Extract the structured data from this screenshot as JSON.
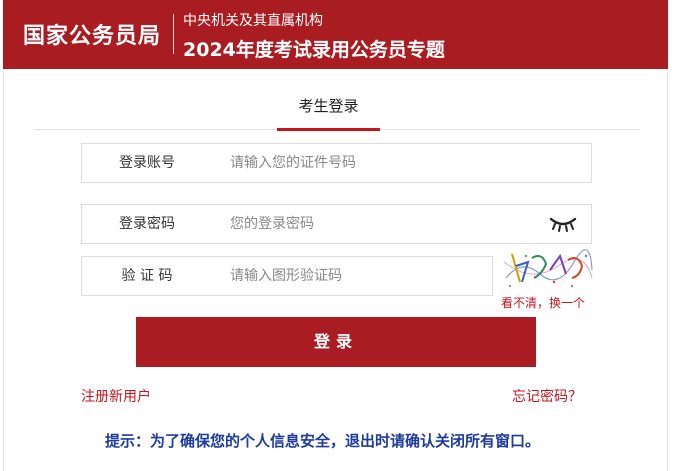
{
  "header": {
    "org": "国家公务员局",
    "subtitle_top": "中央机关及其直属机构",
    "subtitle_main": "2024年度考试录用公务员专题"
  },
  "tab": {
    "label": "考生登录"
  },
  "form": {
    "account": {
      "label": "登录账号",
      "placeholder": "请输入您的证件号码"
    },
    "password": {
      "label": "登录密码",
      "placeholder": "您的登录密码",
      "icon": "eye-closed-icon"
    },
    "captcha": {
      "label": "验 证 码",
      "placeholder": "请输入图形验证码",
      "refresh_label": "看不清，换一个"
    }
  },
  "login_button": {
    "label": "登录"
  },
  "links": {
    "register": "注册新用户",
    "forgot": "忘记密码？"
  },
  "tip": "提示：为了确保您的个人信息安全，退出时请确认关闭所有窗口。",
  "colors": {
    "brand": "#a81c22",
    "link": "#c4161c",
    "tip": "#1f3b9c"
  }
}
